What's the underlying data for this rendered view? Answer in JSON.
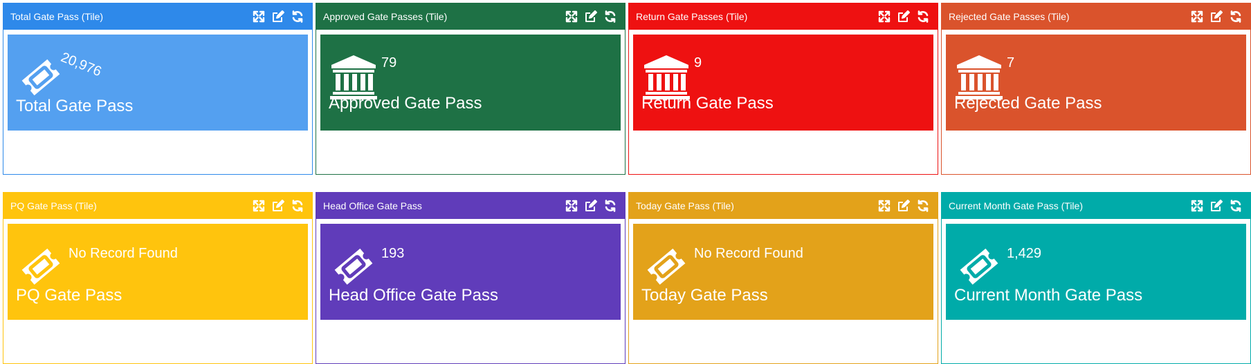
{
  "tools": {
    "expand_icon": "expand-icon",
    "edit_icon": "edit-icon",
    "refresh_icon": "refresh-icon"
  },
  "widgets": [
    {
      "title": "Total Gate Pass (Tile)",
      "count": "20,976",
      "label": "Total Gate Pass",
      "icon": "ticket-icon",
      "header_color": "#2e89ea",
      "tile_color": "#54a0f0",
      "border_color": "#2e89ea"
    },
    {
      "title": "Approved Gate Passes (Tile)",
      "count": "79",
      "label": "Approved Gate Pass",
      "icon": "bank-icon",
      "header_color": "#1e7145",
      "tile_color": "#1e7145",
      "border_color": "#1e7145"
    },
    {
      "title": "Return Gate Passes (Tile)",
      "count": "9",
      "label": "Return Gate Pass",
      "icon": "bank-icon",
      "header_color": "#ee1111",
      "tile_color": "#ee1111",
      "border_color": "#ee1111"
    },
    {
      "title": "Rejected Gate Passes (Tile)",
      "count": "7",
      "label": "Rejected Gate Pass",
      "icon": "bank-icon",
      "header_color": "#da532c",
      "tile_color": "#da532c",
      "border_color": "#da532c"
    },
    {
      "title": "PQ Gate Pass (Tile)",
      "count": "No Record Found",
      "label": "PQ Gate Pass",
      "icon": "ticket-icon",
      "header_color": "#ffc40d",
      "tile_color": "#ffc40d",
      "border_color": "#ffc40d"
    },
    {
      "title": "Head Office Gate Pass",
      "count": "193",
      "label": "Head Office Gate Pass",
      "icon": "ticket-icon",
      "header_color": "#603cba",
      "tile_color": "#603cba",
      "border_color": "#603cba"
    },
    {
      "title": "Today Gate Pass (Tile)",
      "count": "No Record Found",
      "label": "Today Gate Pass",
      "icon": "ticket-icon",
      "header_color": "#e3a21a",
      "tile_color": "#e3a21a",
      "border_color": "#e3a21a"
    },
    {
      "title": "Current Month Gate Pass (Tile)",
      "count": "1,429",
      "label": "Current Month Gate Pass",
      "icon": "ticket-icon",
      "header_color": "#00aba9",
      "tile_color": "#00aba9",
      "border_color": "#00aba9"
    }
  ]
}
